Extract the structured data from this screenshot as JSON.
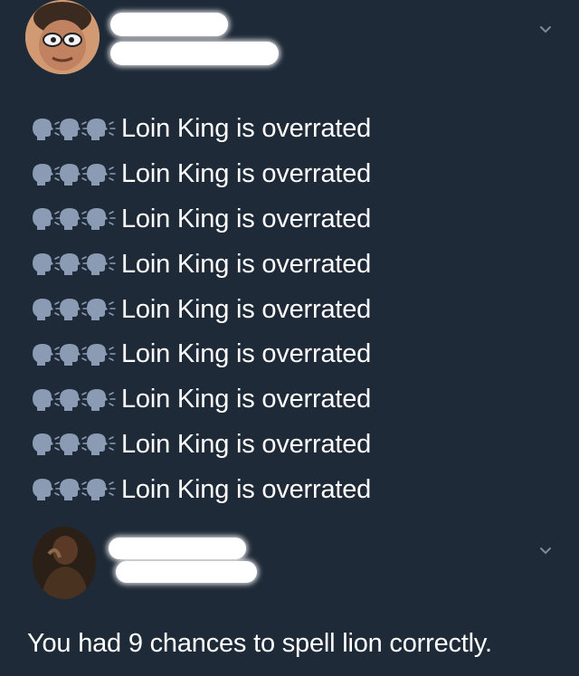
{
  "post": {
    "avatar_icon": "avatar-cartoon-face",
    "repeat_icon": "speaking-head-icon",
    "lines": [
      "Loin King is overrated",
      "Loin King is overrated",
      "Loin King is overrated",
      "Loin King is overrated",
      "Loin King is overrated",
      "Loin King is overrated",
      "Loin King is overrated",
      "Loin King is overrated",
      "Loin King is overrated"
    ]
  },
  "reply": {
    "avatar_icon": "avatar-photo",
    "text": "You had 9 chances to spell lion correctly."
  },
  "colors": {
    "background": "#1f2a38",
    "text": "#ffffff",
    "chevron": "#7d8a99",
    "emoji": "#8a9bb3"
  }
}
